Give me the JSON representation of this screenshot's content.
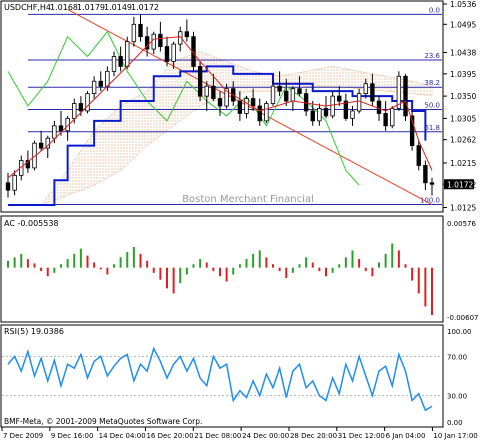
{
  "chart_data": [
    {
      "type": "candlestick",
      "symbol_label": "USDCHF,H4",
      "ohlc_header": [
        "1.0168",
        "1.0179",
        "1.0149",
        "1.0172"
      ],
      "watermark": "Boston Merchant Financial",
      "ylim": [
        1.012,
        1.0536
      ],
      "price_ticks": [
        "1.0536",
        "1.0495",
        "1.0438",
        "1.0395",
        "1.0350",
        "1.0305",
        "1.0262",
        "1.0215",
        "1.0172",
        "1.0125"
      ],
      "current_price": "1.0172",
      "x_tick_labels": [
        "7 Dec 2009",
        "9 Dec 16:00",
        "14 Dec 04:00",
        "16 Dec 20:00",
        "21 Dec 08:00",
        "24 Dec 00:00",
        "28 Dec 20:00",
        "31 Dec 12:00",
        "6 Jan 04:00",
        "10 Jan 17:00"
      ],
      "fibonacci": [
        {
          "label": "0.0",
          "value": 1.0515
        },
        {
          "label": "23.6",
          "value": 1.0423
        },
        {
          "label": "38.2",
          "value": 1.0368
        },
        {
          "label": "50.0",
          "value": 1.0323
        },
        {
          "label": "61.8",
          "value": 1.0278
        },
        {
          "label": "100.0",
          "value": 1.0131
        }
      ],
      "candles": [
        [
          1.0175,
          1.0195,
          1.0145,
          1.016
        ],
        [
          1.016,
          1.02,
          1.015,
          1.019
        ],
        [
          1.019,
          1.023,
          1.018,
          1.022
        ],
        [
          1.022,
          1.024,
          1.0195,
          1.0205
        ],
        [
          1.0205,
          1.026,
          1.02,
          1.0255
        ],
        [
          1.0255,
          1.028,
          1.024,
          1.0245
        ],
        [
          1.0245,
          1.027,
          1.0225,
          1.0265
        ],
        [
          1.0265,
          1.03,
          1.0255,
          1.029
        ],
        [
          1.029,
          1.032,
          1.027,
          1.028
        ],
        [
          1.028,
          1.031,
          1.026,
          1.0305
        ],
        [
          1.0305,
          1.0345,
          1.0295,
          1.0335
        ],
        [
          1.0335,
          1.035,
          1.031,
          1.032
        ],
        [
          1.032,
          1.036,
          1.0315,
          1.0355
        ],
        [
          1.0355,
          1.039,
          1.0345,
          1.038
        ],
        [
          1.038,
          1.04,
          1.036,
          1.037
        ],
        [
          1.037,
          1.041,
          1.036,
          1.04
        ],
        [
          1.04,
          1.044,
          1.039,
          1.043
        ],
        [
          1.043,
          1.045,
          1.04,
          1.041
        ],
        [
          1.041,
          1.047,
          1.0405,
          1.046
        ],
        [
          1.046,
          1.051,
          1.045,
          1.0495
        ],
        [
          1.0495,
          1.0515,
          1.046,
          1.047
        ],
        [
          1.047,
          1.049,
          1.043,
          1.0445
        ],
        [
          1.0445,
          1.048,
          1.0435,
          1.0475
        ],
        [
          1.0475,
          1.05,
          1.044,
          1.045
        ],
        [
          1.045,
          1.047,
          1.041,
          1.042
        ],
        [
          1.042,
          1.046,
          1.0405,
          1.0455
        ],
        [
          1.0455,
          1.049,
          1.044,
          1.048
        ],
        [
          1.048,
          1.0505,
          1.046,
          1.047
        ],
        [
          1.047,
          1.048,
          1.04,
          1.041
        ],
        [
          1.041,
          1.042,
          1.034,
          1.035
        ],
        [
          1.035,
          1.038,
          1.032,
          1.037
        ],
        [
          1.037,
          1.0395,
          1.034,
          1.0345
        ],
        [
          1.0345,
          1.036,
          1.031,
          1.033
        ],
        [
          1.033,
          1.0375,
          1.0325,
          1.0365
        ],
        [
          1.0365,
          1.038,
          1.033,
          1.034
        ],
        [
          1.034,
          1.036,
          1.03,
          1.0315
        ],
        [
          1.0315,
          1.035,
          1.0305,
          1.0345
        ],
        [
          1.0345,
          1.0365,
          1.032,
          1.033
        ],
        [
          1.033,
          1.0345,
          1.029,
          1.03
        ],
        [
          1.03,
          1.034,
          1.0295,
          1.0335
        ],
        [
          1.0335,
          1.038,
          1.033,
          1.037
        ],
        [
          1.037,
          1.04,
          1.035,
          1.036
        ],
        [
          1.036,
          1.0385,
          1.033,
          1.034
        ],
        [
          1.034,
          1.037,
          1.032,
          1.0365
        ],
        [
          1.0365,
          1.039,
          1.035,
          1.0355
        ],
        [
          1.0355,
          1.0365,
          1.031,
          1.032
        ],
        [
          1.032,
          1.034,
          1.029,
          1.03
        ],
        [
          1.03,
          1.0335,
          1.029,
          1.0325
        ],
        [
          1.0325,
          1.035,
          1.0305,
          1.031
        ],
        [
          1.031,
          1.036,
          1.0305,
          1.035
        ],
        [
          1.035,
          1.037,
          1.033,
          1.034
        ],
        [
          1.034,
          1.0355,
          1.03,
          1.0305
        ],
        [
          1.0305,
          1.033,
          1.029,
          1.032
        ],
        [
          1.032,
          1.0365,
          1.0315,
          1.0355
        ],
        [
          1.0355,
          1.0385,
          1.0345,
          1.0375
        ],
        [
          1.0375,
          1.0395,
          1.033,
          1.034
        ],
        [
          1.034,
          1.035,
          1.03,
          1.0315
        ],
        [
          1.0315,
          1.034,
          1.028,
          1.029
        ],
        [
          1.029,
          1.033,
          1.0285,
          1.0325
        ],
        [
          1.0325,
          1.04,
          1.032,
          1.039
        ],
        [
          1.039,
          1.0395,
          1.03,
          1.031
        ],
        [
          1.031,
          1.032,
          1.024,
          1.025
        ],
        [
          1.025,
          1.026,
          1.02,
          1.021
        ],
        [
          1.021,
          1.022,
          1.016,
          1.0175
        ],
        [
          1.0175,
          1.0185,
          1.0149,
          1.0172
        ]
      ],
      "ema_fast": [
        [
          0,
          1.0185
        ],
        [
          6,
          1.025
        ],
        [
          12,
          1.033
        ],
        [
          18,
          1.041
        ],
        [
          22,
          1.0465
        ],
        [
          26,
          1.047
        ],
        [
          29,
          1.042
        ],
        [
          33,
          1.036
        ],
        [
          38,
          1.032
        ],
        [
          43,
          1.034
        ],
        [
          48,
          1.033
        ],
        [
          53,
          1.034
        ],
        [
          57,
          1.032
        ],
        [
          60,
          1.034
        ],
        [
          62,
          1.026
        ],
        [
          64,
          1.02
        ]
      ],
      "ema_slow": [
        [
          0,
          1.013
        ],
        [
          4,
          1.013
        ],
        [
          7,
          1.018
        ],
        [
          9,
          1.025
        ],
        [
          13,
          1.03
        ],
        [
          17,
          1.034
        ],
        [
          22,
          1.039
        ],
        [
          26,
          1.04
        ],
        [
          30,
          1.041
        ],
        [
          34,
          1.0395
        ],
        [
          40,
          1.0375
        ],
        [
          46,
          1.036
        ],
        [
          52,
          1.035
        ],
        [
          58,
          1.034
        ],
        [
          61,
          1.032
        ],
        [
          63,
          1.026
        ]
      ],
      "lagging_span": [
        [
          0,
          1.04
        ],
        [
          3,
          1.033
        ],
        [
          6,
          1.038
        ],
        [
          9,
          1.047
        ],
        [
          12,
          1.043
        ],
        [
          15,
          1.048
        ],
        [
          18,
          1.04
        ],
        [
          21,
          1.034
        ],
        [
          24,
          1.03
        ],
        [
          27,
          1.038
        ],
        [
          30,
          1.034
        ],
        [
          33,
          1.031
        ],
        [
          36,
          1.035
        ],
        [
          39,
          1.029
        ],
        [
          42,
          1.037
        ],
        [
          45,
          1.034
        ],
        [
          48,
          1.03
        ],
        [
          51,
          1.02
        ],
        [
          53,
          1.017
        ]
      ],
      "cloud_a": [
        [
          5,
          1.013
        ],
        [
          9,
          1.02
        ],
        [
          13,
          1.028
        ],
        [
          17,
          1.033
        ],
        [
          21,
          1.036
        ],
        [
          25,
          1.042
        ],
        [
          29,
          1.044
        ],
        [
          33,
          1.042
        ],
        [
          37,
          1.04
        ],
        [
          41,
          1.039
        ],
        [
          45,
          1.04
        ],
        [
          49,
          1.041
        ],
        [
          53,
          1.04
        ],
        [
          57,
          1.039
        ],
        [
          61,
          1.038
        ],
        [
          64,
          1.037
        ]
      ],
      "cloud_b": [
        [
          5,
          1.013
        ],
        [
          9,
          1.015
        ],
        [
          13,
          1.017
        ],
        [
          17,
          1.02
        ],
        [
          21,
          1.025
        ],
        [
          25,
          1.029
        ],
        [
          29,
          1.033
        ],
        [
          33,
          1.035
        ],
        [
          37,
          1.036
        ],
        [
          41,
          1.036
        ],
        [
          45,
          1.037
        ],
        [
          49,
          1.037
        ],
        [
          53,
          1.0365
        ],
        [
          57,
          1.036
        ],
        [
          61,
          1.0355
        ],
        [
          64,
          1.035
        ]
      ],
      "trendline": [
        [
          9,
          1.0525
        ],
        [
          64,
          1.0131
        ]
      ]
    },
    {
      "type": "bar",
      "label": "AC -0.005538",
      "ylim": [
        -0.00607,
        0.00576
      ],
      "y_ticks": [
        "0.00576",
        "-0.00607"
      ],
      "values": [
        0.0008,
        0.0012,
        0.0016,
        0.001,
        0.0005,
        -0.0004,
        -0.001,
        -0.0006,
        0.0004,
        0.001,
        0.0016,
        0.0022,
        0.0014,
        0.0006,
        -0.0002,
        -0.0008,
        0.0004,
        0.0012,
        0.0018,
        0.0024,
        0.0016,
        0.0008,
        -0.0006,
        -0.0014,
        -0.0024,
        -0.003,
        -0.0018,
        -0.0008,
        0.0004,
        0.001,
        0.0006,
        -0.0004,
        -0.001,
        -0.0016,
        -0.0008,
        0.0004,
        0.001,
        0.0016,
        0.002,
        0.0012,
        0.0004,
        -0.0004,
        -0.0012,
        -0.0006,
        0.0004,
        0.0012,
        0.0006,
        -0.0004,
        -0.001,
        -0.0006,
        0.0004,
        0.0012,
        0.002,
        0.001,
        -0.0004,
        -0.001,
        0.0006,
        0.0016,
        0.0028,
        0.002,
        0.0004,
        -0.0015,
        -0.003,
        -0.0045,
        -0.0055
      ]
    },
    {
      "type": "line",
      "label": "RSI(5) 19.0386",
      "ylim": [
        0,
        100
      ],
      "y_ticks": [
        "100.00",
        "70.00",
        "30.00",
        "0.00"
      ],
      "values": [
        62,
        70,
        55,
        75,
        50,
        68,
        45,
        66,
        40,
        62,
        58,
        72,
        48,
        65,
        70,
        50,
        60,
        68,
        72,
        45,
        62,
        55,
        78,
        65,
        48,
        62,
        70,
        55,
        68,
        48,
        40,
        70,
        58,
        62,
        25,
        35,
        28,
        45,
        30,
        52,
        38,
        58,
        28,
        55,
        62,
        38,
        45,
        30,
        25,
        48,
        32,
        62,
        45,
        70,
        50,
        30,
        55,
        60,
        40,
        72,
        55,
        25,
        32,
        15,
        19
      ]
    }
  ],
  "copyright": "BMF-Meta, © 2001-2009 MetaQuotes Software Corp."
}
